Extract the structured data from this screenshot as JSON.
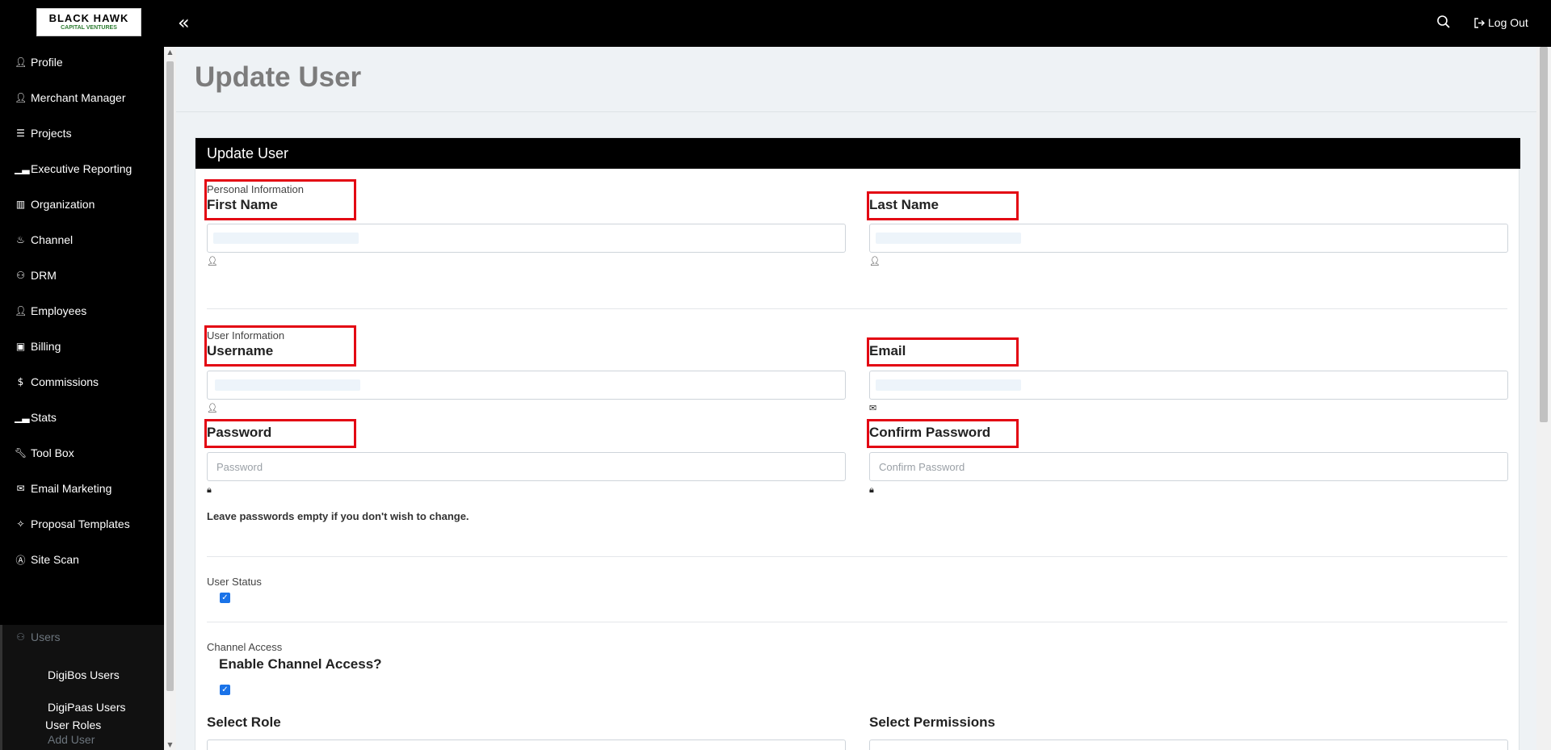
{
  "logo": {
    "line1": "BLACK HAWK",
    "line2": "CAPITAL VENTURES"
  },
  "topbar": {
    "logout_label": "Log Out"
  },
  "sidebar": {
    "items": [
      {
        "label": "Profile",
        "icon": "user-icon"
      },
      {
        "label": "Merchant Manager",
        "icon": "user-icon"
      },
      {
        "label": "Projects",
        "icon": "projects-icon"
      },
      {
        "label": "Executive Reporting",
        "icon": "bar-chart-icon"
      },
      {
        "label": "Organization",
        "icon": "building-icon"
      },
      {
        "label": "Channel",
        "icon": "fire-icon"
      },
      {
        "label": "DRM",
        "icon": "users-icon"
      },
      {
        "label": "Employees",
        "icon": "user-icon"
      },
      {
        "label": "Billing",
        "icon": "money-icon"
      },
      {
        "label": "Commissions",
        "icon": "dollar-icon"
      },
      {
        "label": "Stats",
        "icon": "bar-chart-icon"
      },
      {
        "label": "Tool Box",
        "icon": "wrench-icon"
      },
      {
        "label": "Email Marketing",
        "icon": "envelope-icon"
      },
      {
        "label": "Proposal Templates",
        "icon": "handshake-icon"
      },
      {
        "label": "Site Scan",
        "icon": "accessibility-icon"
      },
      {
        "label": "Users",
        "icon": "users-icon"
      }
    ],
    "users_submenu": [
      "DigiBos Users",
      "DigiPaas Users",
      "Add User",
      "User Roles"
    ]
  },
  "page": {
    "title": "Update User"
  },
  "card": {
    "header": "Update User"
  },
  "form": {
    "personal_section": "Personal Information",
    "first_name_label": "First Name",
    "last_name_label": "Last Name",
    "user_section": "User Information",
    "username_label": "Username",
    "email_label": "Email",
    "password_label": "Password",
    "password_placeholder": "Password",
    "confirm_password_label": "Confirm Password",
    "confirm_password_placeholder": "Confirm Password",
    "password_note": "Leave passwords empty if you don't wish to change.",
    "user_status_label": "User Status",
    "user_status_checked": true,
    "channel_access_section": "Channel Access",
    "enable_channel_access_label": "Enable Channel Access?",
    "channel_access_checked": true,
    "select_role_label": "Select Role",
    "select_permissions_label": "Select Permissions"
  },
  "colors": {
    "highlight": "#e30613",
    "checkbox": "#1a73e8",
    "header_bg": "#000000"
  }
}
